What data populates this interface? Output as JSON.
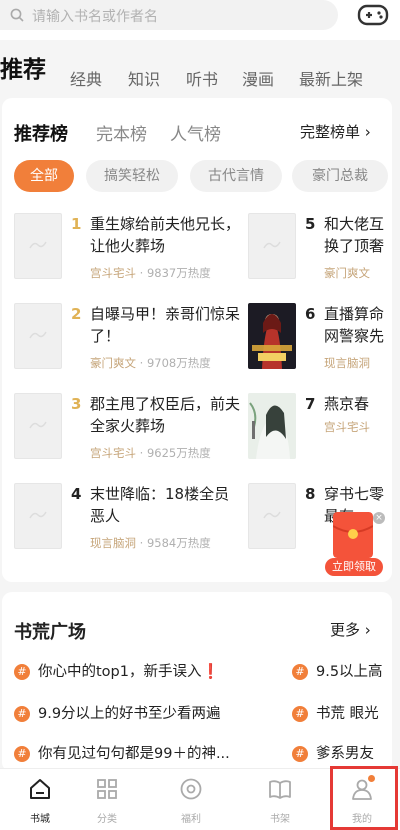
{
  "search": {
    "placeholder": "请输入书名或作者名"
  },
  "cat_tabs": [
    "推荐",
    "经典",
    "知识",
    "听书",
    "漫画",
    "最新上架"
  ],
  "rank": {
    "tabs": [
      "推荐榜",
      "完本榜",
      "人气榜"
    ],
    "full_list": "完整榜单 ›",
    "chips": [
      "全部",
      "搞笑轻松",
      "古代言情",
      "豪门总裁"
    ],
    "books": [
      {
        "rank": "1",
        "title": "重生嫁给前夫他兄长，让他火葬场",
        "tag": "宫斗宅斗",
        "heat": "· 9837万热度"
      },
      {
        "rank": "2",
        "title": "自曝马甲！亲哥们惊呆了！",
        "tag": "豪门爽文",
        "heat": "· 9708万热度"
      },
      {
        "rank": "3",
        "title": "郡主甩了权臣后，前夫全家火葬场",
        "tag": "宫斗宅斗",
        "heat": "· 9625万热度"
      },
      {
        "rank": "4",
        "title": "末世降临：18楼全员恶人",
        "tag": "现言脑洞",
        "heat": "· 9584万热度"
      },
      {
        "rank": "5",
        "title": "和大佬互换了顶奢",
        "tag": "豪门爽文",
        "heat": ""
      },
      {
        "rank": "6",
        "title": "直播算命网警察先",
        "tag": "现言脑洞",
        "heat": ""
      },
      {
        "rank": "7",
        "title": "燕京春",
        "tag": "宫斗宅斗",
        "heat": ""
      },
      {
        "rank": "8",
        "title": "穿书七零最有",
        "tag": "",
        "heat": ""
      }
    ],
    "red_packet_label": "立即领取"
  },
  "plaza": {
    "title": "书荒广场",
    "more": "更多 ›",
    "topics_left": [
      {
        "text": "你心中的top1，新手误入",
        "warn": "❗"
      },
      {
        "text": "9.9分以上的好书至少看两遍",
        "warn": ""
      },
      {
        "text": "你有见过句句都是99＋的神...",
        "warn": ""
      }
    ],
    "topics_right": [
      "9.5以上高",
      "书荒 眼光",
      "爹系男友"
    ]
  },
  "nav": [
    "书城",
    "分类",
    "福利",
    "书架",
    "我的"
  ],
  "colors": {
    "accent": "#f17f3a",
    "highlight": "#e53935",
    "gold": "#e0b255"
  }
}
